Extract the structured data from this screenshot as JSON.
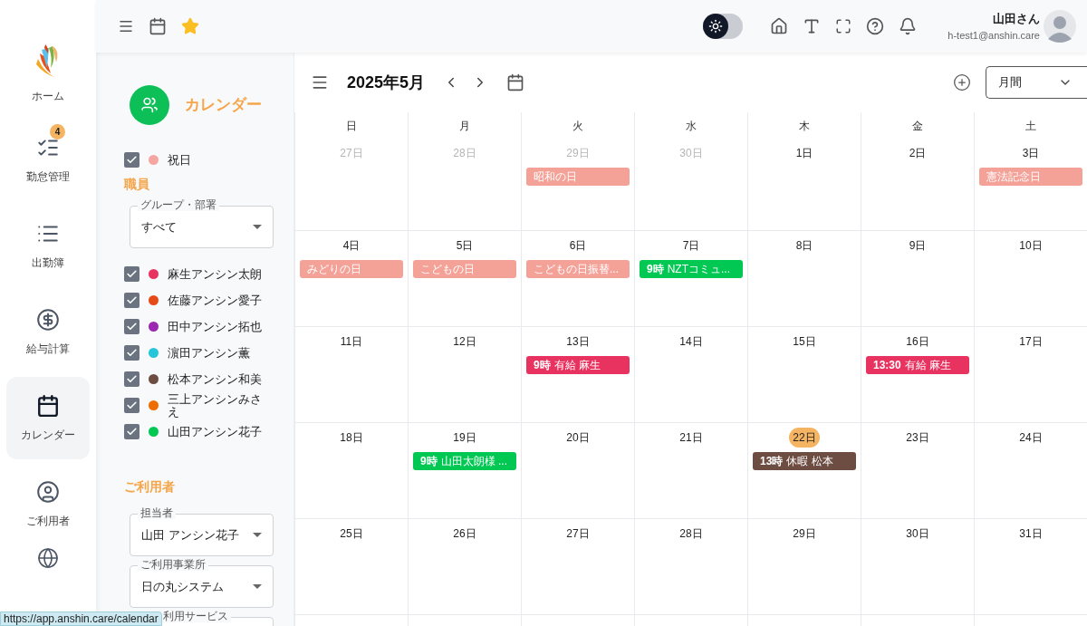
{
  "nav": {
    "items": [
      {
        "label": "ホーム",
        "selected": false
      },
      {
        "label": "勤怠管理",
        "badge": "4",
        "selected": false
      },
      {
        "label": "出勤簿",
        "selected": false
      },
      {
        "label": "給与計算",
        "selected": false
      },
      {
        "label": "カレンダー",
        "selected": true
      },
      {
        "label": "ご利用者",
        "selected": false
      },
      {
        "selected": false
      }
    ]
  },
  "topbar": {
    "theme_toggle": {
      "on": false
    },
    "user_name": "山田さん",
    "user_email": "h-test1@anshin.care"
  },
  "filters": {
    "title": "カレンダー",
    "holiday": {
      "label": "祝日",
      "checked": true,
      "color": "#f6a6a0"
    },
    "staff_heading": "職員",
    "group_select": {
      "label": "グループ・部署",
      "value": "すべて"
    },
    "staff": [
      {
        "name": "麻生アンシン太朗",
        "checked": true,
        "color": "#e8325f"
      },
      {
        "name": "佐藤アンシン愛子",
        "checked": true,
        "color": "#e64a19"
      },
      {
        "name": "田中アンシン拓也",
        "checked": true,
        "color": "#9c27b0"
      },
      {
        "name": "濵田アンシン薫",
        "checked": true,
        "color": "#26c6da"
      },
      {
        "name": "松本アンシン和美",
        "checked": true,
        "color": "#6d4c41"
      },
      {
        "name": "三上アンシンみさえ",
        "checked": true,
        "color": "#ef6c00"
      },
      {
        "name": "山田アンシン花子",
        "checked": true,
        "color": "#00c853"
      }
    ],
    "users_heading": "ご利用者",
    "user_selects": [
      {
        "label": "担当者",
        "value": "山田 アンシン花子"
      },
      {
        "label": "ご利用事業所",
        "value": "日の丸システム"
      },
      {
        "label": "利用サービス"
      }
    ]
  },
  "calendar": {
    "title": "2025年5月",
    "view": "月間",
    "weekdays": [
      "日",
      "月",
      "火",
      "水",
      "木",
      "金",
      "土"
    ],
    "weeks": [
      {
        "days": [
          {
            "label": "27日",
            "muted": true,
            "today": false
          },
          {
            "label": "28日",
            "muted": true,
            "today": false
          },
          {
            "label": "29日",
            "muted": true,
            "today": false,
            "events": [
              {
                "title": "昭和の日",
                "color": "#f4a198"
              }
            ]
          },
          {
            "label": "30日",
            "muted": true,
            "today": false
          },
          {
            "label": "1日",
            "muted": false,
            "today": false
          },
          {
            "label": "2日",
            "muted": false,
            "today": false
          },
          {
            "label": "3日",
            "muted": false,
            "today": false,
            "events": [
              {
                "title": "憲法記念日",
                "color": "#f4a198"
              }
            ]
          }
        ]
      },
      {
        "days": [
          {
            "label": "4日",
            "muted": false,
            "today": false,
            "events": [
              {
                "title": "みどりの日",
                "color": "#f4a198"
              }
            ]
          },
          {
            "label": "5日",
            "muted": false,
            "today": false,
            "events": [
              {
                "title": "こどもの日",
                "color": "#f4a198"
              }
            ]
          },
          {
            "label": "6日",
            "muted": false,
            "today": false,
            "events": [
              {
                "title": "こどもの日振替...",
                "color": "#f4a198"
              }
            ]
          },
          {
            "label": "7日",
            "muted": false,
            "today": false,
            "events": [
              {
                "time": "9時",
                "title": "NZTコミュ...",
                "color": "#00c853"
              }
            ]
          },
          {
            "label": "8日",
            "muted": false,
            "today": false
          },
          {
            "label": "9日",
            "muted": false,
            "today": false
          },
          {
            "label": "10日",
            "muted": false,
            "today": false
          }
        ]
      },
      {
        "days": [
          {
            "label": "11日",
            "muted": false,
            "today": false
          },
          {
            "label": "12日",
            "muted": false,
            "today": false
          },
          {
            "label": "13日",
            "muted": false,
            "today": false,
            "events": [
              {
                "time": "9時",
                "title": "有給 麻生",
                "color": "#e8325f"
              }
            ]
          },
          {
            "label": "14日",
            "muted": false,
            "today": false
          },
          {
            "label": "15日",
            "muted": false,
            "today": false
          },
          {
            "label": "16日",
            "muted": false,
            "today": false,
            "events": [
              {
                "time": "13:30",
                "title": "有給 麻生",
                "color": "#e8325f"
              }
            ]
          },
          {
            "label": "17日",
            "muted": false,
            "today": false
          }
        ]
      },
      {
        "days": [
          {
            "label": "18日",
            "muted": false,
            "today": false
          },
          {
            "label": "19日",
            "muted": false,
            "today": false,
            "events": [
              {
                "time": "9時",
                "title": "山田太朗様 ...",
                "color": "#00c853"
              }
            ]
          },
          {
            "label": "20日",
            "muted": false,
            "today": false
          },
          {
            "label": "21日",
            "muted": false,
            "today": false
          },
          {
            "label": "22日",
            "muted": false,
            "today": true,
            "events": [
              {
                "time": "13時",
                "title": "休暇 松本",
                "color": "#6d4c41"
              }
            ]
          },
          {
            "label": "23日",
            "muted": false,
            "today": false
          },
          {
            "label": "24日",
            "muted": false,
            "today": false
          }
        ]
      },
      {
        "days": [
          {
            "label": "25日",
            "muted": false,
            "today": false
          },
          {
            "label": "26日",
            "muted": false,
            "today": false
          },
          {
            "label": "27日",
            "muted": false,
            "today": false
          },
          {
            "label": "28日",
            "muted": false,
            "today": false
          },
          {
            "label": "29日",
            "muted": false,
            "today": false
          },
          {
            "label": "30日",
            "muted": false,
            "today": false
          },
          {
            "label": "31日",
            "muted": false,
            "today": false
          }
        ]
      }
    ]
  },
  "status_url": "https://app.anshin.care/calendar"
}
